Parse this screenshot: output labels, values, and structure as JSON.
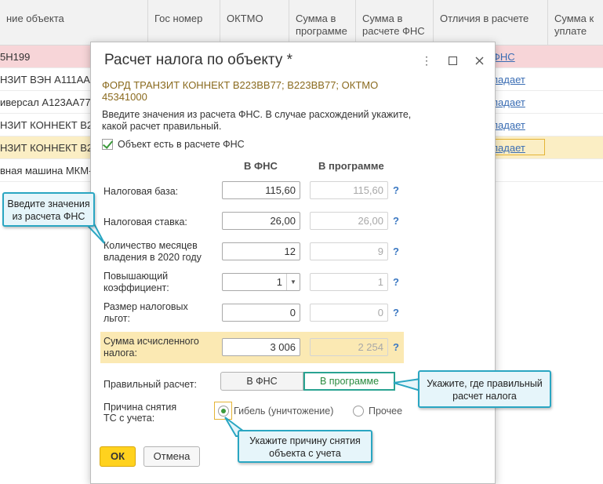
{
  "background": {
    "columns": [
      "ние объекта",
      "Гос номер",
      "ОКТМО",
      "Сумма в программе",
      "Сумма в расчете ФНС",
      "Отличия в расчете",
      "Сумма к уплате"
    ],
    "rows": [
      {
        "name": "5Н199",
        "diff": "ФНС"
      },
      {
        "name": "НЗИТ ВЭН А111АА",
        "diff": "падает"
      },
      {
        "name": "иверсал А123АА77",
        "diff": "падает"
      },
      {
        "name": "НЗИТ КОННЕКТ В2",
        "diff": "падает"
      },
      {
        "name": "НЗИТ КОННЕКТ В2",
        "diff": "падает"
      },
      {
        "name": "вная машина МКМ-",
        "diff": ""
      }
    ]
  },
  "dialog": {
    "title": "Расчет налога по объекту *",
    "object_name": "ФОРД ТРАНЗИТ КОННЕКТ В223ВВ77; В223ВВ77; ОКТМО 45341000",
    "intro": "Введите значения из расчета ФНС. В случае расхождений укажите, какой расчет правильный.",
    "checkbox_label": "Объект есть в расчете ФНС",
    "col_fns": "В ФНС",
    "col_program": "В программе",
    "fields": [
      {
        "label": "Налоговая база:",
        "fns": "115,60",
        "program": "115,60",
        "help": "?"
      },
      {
        "label": "Налоговая ставка:",
        "fns": "26,00",
        "program": "26,00",
        "help": "?"
      },
      {
        "label": "Количество месяцев владения в 2020 году",
        "fns": "12",
        "program": "9",
        "help": "?"
      },
      {
        "label": "Повышающий коэффициент:",
        "fns": "1",
        "program": "1",
        "help": "?"
      },
      {
        "label": "Размер налоговых льгот:",
        "fns": "0",
        "program": "0",
        "help": "?"
      },
      {
        "label": "Сумма исчисленного налога:",
        "fns": "3 006",
        "program": "2 254",
        "help": "?"
      }
    ],
    "correct_label": "Правильный расчет:",
    "correct_options": [
      "В ФНС",
      "В программе"
    ],
    "reason_label": "Причина снятия ТС с учета:",
    "reason_options": [
      "Гибель (уничтожение)",
      "Прочее"
    ],
    "ok_label": "ОК",
    "cancel_label": "Отмена"
  },
  "callouts": {
    "fns_values": "Введите значения из расчета ФНС",
    "correct_calc": "Укажите, где правильный расчет налога",
    "reason": "Укажите причину снятия объекта с учета"
  },
  "colors": {
    "accent_yellow": "#ffd21e",
    "callout_border": "#2aa6c2",
    "row_pink": "#f7d5d8",
    "row_yellow": "#fbeec4"
  }
}
